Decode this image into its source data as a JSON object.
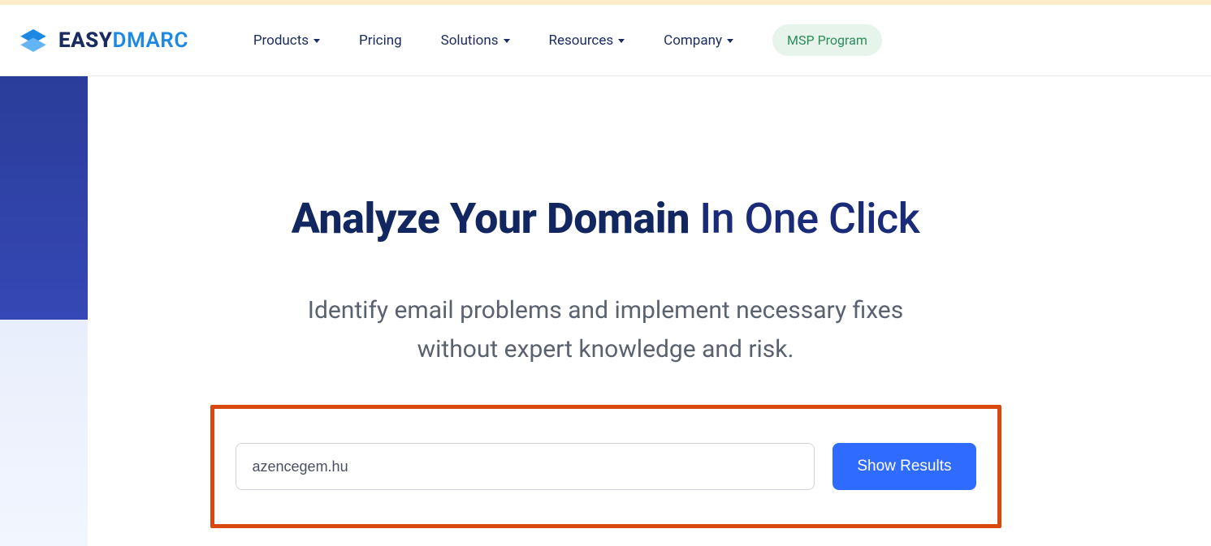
{
  "logo": {
    "part1": "EASY",
    "part2": "DMARC"
  },
  "nav": {
    "products": "Products",
    "pricing": "Pricing",
    "solutions": "Solutions",
    "resources": "Resources",
    "company": "Company",
    "msp": "MSP Program"
  },
  "hero": {
    "title_bold": "Analyze Your Domain",
    "title_light": " In One Click",
    "subtitle_line1": "Identify email problems and implement necessary fixes",
    "subtitle_line2": "without expert knowledge and risk."
  },
  "search": {
    "domain_value": "azencegem.hu",
    "button_label": "Show Results"
  }
}
